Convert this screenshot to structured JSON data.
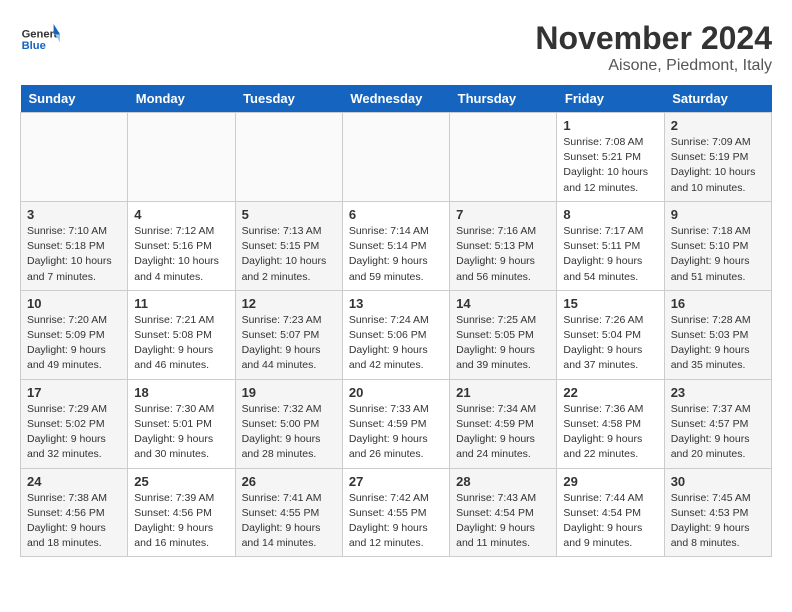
{
  "logo": {
    "line1": "General",
    "line2": "Blue"
  },
  "title": "November 2024",
  "location": "Aisone, Piedmont, Italy",
  "weekdays": [
    "Sunday",
    "Monday",
    "Tuesday",
    "Wednesday",
    "Thursday",
    "Friday",
    "Saturday"
  ],
  "weeks": [
    [
      {
        "day": "",
        "info": ""
      },
      {
        "day": "",
        "info": ""
      },
      {
        "day": "",
        "info": ""
      },
      {
        "day": "",
        "info": ""
      },
      {
        "day": "",
        "info": ""
      },
      {
        "day": "1",
        "info": "Sunrise: 7:08 AM\nSunset: 5:21 PM\nDaylight: 10 hours and 12 minutes."
      },
      {
        "day": "2",
        "info": "Sunrise: 7:09 AM\nSunset: 5:19 PM\nDaylight: 10 hours and 10 minutes."
      }
    ],
    [
      {
        "day": "3",
        "info": "Sunrise: 7:10 AM\nSunset: 5:18 PM\nDaylight: 10 hours and 7 minutes."
      },
      {
        "day": "4",
        "info": "Sunrise: 7:12 AM\nSunset: 5:16 PM\nDaylight: 10 hours and 4 minutes."
      },
      {
        "day": "5",
        "info": "Sunrise: 7:13 AM\nSunset: 5:15 PM\nDaylight: 10 hours and 2 minutes."
      },
      {
        "day": "6",
        "info": "Sunrise: 7:14 AM\nSunset: 5:14 PM\nDaylight: 9 hours and 59 minutes."
      },
      {
        "day": "7",
        "info": "Sunrise: 7:16 AM\nSunset: 5:13 PM\nDaylight: 9 hours and 56 minutes."
      },
      {
        "day": "8",
        "info": "Sunrise: 7:17 AM\nSunset: 5:11 PM\nDaylight: 9 hours and 54 minutes."
      },
      {
        "day": "9",
        "info": "Sunrise: 7:18 AM\nSunset: 5:10 PM\nDaylight: 9 hours and 51 minutes."
      }
    ],
    [
      {
        "day": "10",
        "info": "Sunrise: 7:20 AM\nSunset: 5:09 PM\nDaylight: 9 hours and 49 minutes."
      },
      {
        "day": "11",
        "info": "Sunrise: 7:21 AM\nSunset: 5:08 PM\nDaylight: 9 hours and 46 minutes."
      },
      {
        "day": "12",
        "info": "Sunrise: 7:23 AM\nSunset: 5:07 PM\nDaylight: 9 hours and 44 minutes."
      },
      {
        "day": "13",
        "info": "Sunrise: 7:24 AM\nSunset: 5:06 PM\nDaylight: 9 hours and 42 minutes."
      },
      {
        "day": "14",
        "info": "Sunrise: 7:25 AM\nSunset: 5:05 PM\nDaylight: 9 hours and 39 minutes."
      },
      {
        "day": "15",
        "info": "Sunrise: 7:26 AM\nSunset: 5:04 PM\nDaylight: 9 hours and 37 minutes."
      },
      {
        "day": "16",
        "info": "Sunrise: 7:28 AM\nSunset: 5:03 PM\nDaylight: 9 hours and 35 minutes."
      }
    ],
    [
      {
        "day": "17",
        "info": "Sunrise: 7:29 AM\nSunset: 5:02 PM\nDaylight: 9 hours and 32 minutes."
      },
      {
        "day": "18",
        "info": "Sunrise: 7:30 AM\nSunset: 5:01 PM\nDaylight: 9 hours and 30 minutes."
      },
      {
        "day": "19",
        "info": "Sunrise: 7:32 AM\nSunset: 5:00 PM\nDaylight: 9 hours and 28 minutes."
      },
      {
        "day": "20",
        "info": "Sunrise: 7:33 AM\nSunset: 4:59 PM\nDaylight: 9 hours and 26 minutes."
      },
      {
        "day": "21",
        "info": "Sunrise: 7:34 AM\nSunset: 4:59 PM\nDaylight: 9 hours and 24 minutes."
      },
      {
        "day": "22",
        "info": "Sunrise: 7:36 AM\nSunset: 4:58 PM\nDaylight: 9 hours and 22 minutes."
      },
      {
        "day": "23",
        "info": "Sunrise: 7:37 AM\nSunset: 4:57 PM\nDaylight: 9 hours and 20 minutes."
      }
    ],
    [
      {
        "day": "24",
        "info": "Sunrise: 7:38 AM\nSunset: 4:56 PM\nDaylight: 9 hours and 18 minutes."
      },
      {
        "day": "25",
        "info": "Sunrise: 7:39 AM\nSunset: 4:56 PM\nDaylight: 9 hours and 16 minutes."
      },
      {
        "day": "26",
        "info": "Sunrise: 7:41 AM\nSunset: 4:55 PM\nDaylight: 9 hours and 14 minutes."
      },
      {
        "day": "27",
        "info": "Sunrise: 7:42 AM\nSunset: 4:55 PM\nDaylight: 9 hours and 12 minutes."
      },
      {
        "day": "28",
        "info": "Sunrise: 7:43 AM\nSunset: 4:54 PM\nDaylight: 9 hours and 11 minutes."
      },
      {
        "day": "29",
        "info": "Sunrise: 7:44 AM\nSunset: 4:54 PM\nDaylight: 9 hours and 9 minutes."
      },
      {
        "day": "30",
        "info": "Sunrise: 7:45 AM\nSunset: 4:53 PM\nDaylight: 9 hours and 8 minutes."
      }
    ]
  ]
}
